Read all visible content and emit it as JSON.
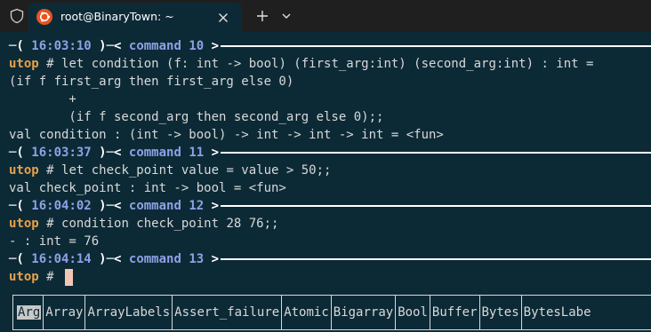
{
  "tab": {
    "title": "root@BinaryTown: ~"
  },
  "icons": {
    "shield": "shield-icon",
    "ubuntu": "ubuntu-icon",
    "close": "close-icon",
    "new_tab": "plus-icon",
    "menu": "chevron-down-icon"
  },
  "colors": {
    "background": "#0c2a36",
    "prompt": "#e8a14a",
    "timestamp": "#8fa0e6",
    "cursor": "#f3c6b4"
  },
  "prompt": {
    "name": "utop",
    "hash": " # "
  },
  "blocks": [
    {
      "time": "16:03:10",
      "command": "command 10"
    },
    {
      "time": "16:03:37",
      "command": "command 11"
    },
    {
      "time": "16:04:02",
      "command": "command 12"
    },
    {
      "time": "16:04:14",
      "command": "command 13"
    }
  ],
  "lines": {
    "in10a": "let condition (f: int -> bool) (first_arg:int) (second_arg:int) : int =",
    "in10b": "(if f first_arg then first_arg else 0)",
    "in10c": "        +",
    "in10d": "        (if f second_arg then second_arg else 0);;",
    "out10": "val condition : (int -> bool) -> int -> int -> int = <fun>",
    "in11": "let check_point value = value > 50;;",
    "out11": "val check_point : int -> bool = <fun>",
    "in12": "condition check_point 28 76;;",
    "out12": "- : int = 76"
  },
  "completion": {
    "selected": "Arg",
    "items": [
      "Array",
      "ArrayLabels",
      "Assert_failure",
      "Atomic",
      "Bigarray",
      "Bool",
      "Buffer",
      "Bytes",
      "BytesLabe"
    ]
  }
}
